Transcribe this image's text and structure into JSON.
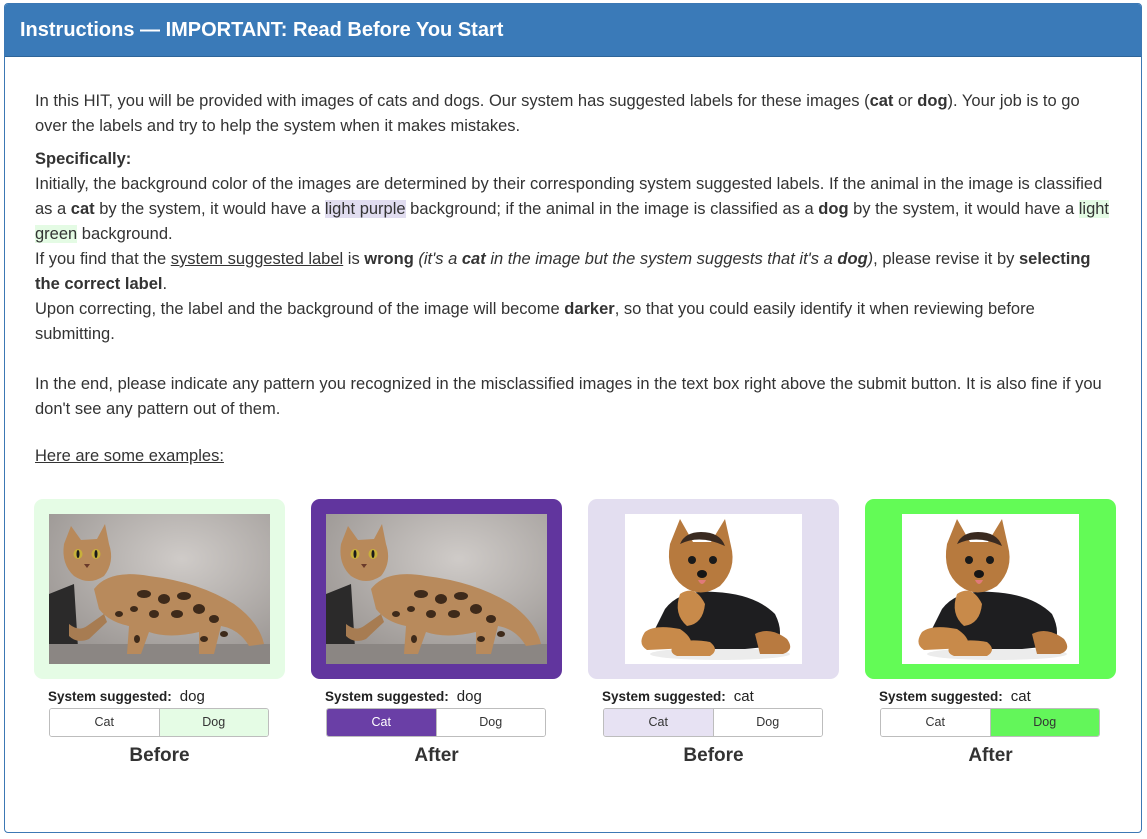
{
  "header": {
    "title": "Instructions — IMPORTANT: Read Before You Start"
  },
  "intro": {
    "t1": "In this HIT, you will be provided with images of cats and dogs. Our system has suggested labels for these images (",
    "cat": "cat",
    "or": " or ",
    "dog": "dog",
    "t2": "). Your job is to go over the labels and try to help the system when it makes mistakes."
  },
  "specifically": {
    "heading": "Specifically:",
    "s1": "Initially, the background color of the images are determined by their corresponding system suggested labels. If the animal in the image is classified as a ",
    "cat": "cat",
    "s2": " by the system, it would have a ",
    "light_purple": "light purple",
    "s3": " background; if the animal in the image is classified as a ",
    "dog": "dog",
    "s4": " by the system, it would have a ",
    "light_green": "light green",
    "s5": " background.",
    "s6": "If you find that the ",
    "system_suggested_label": "system suggested label",
    "s7": " is ",
    "wrong": "wrong",
    "s8": " (it's a ",
    "cat2": "cat",
    "s9": " in the image but the system suggests that it's a ",
    "dog2": "dog",
    "s10": ")",
    "s11": ", please revise it by ",
    "selecting": "selecting the correct label",
    "s12": ".",
    "s13": "Upon correcting, the label and the background of the image will become ",
    "darker": "darker",
    "s14": ", so that you could easily identify it when reviewing before submitting."
  },
  "pattern_text": "In the end, please indicate any pattern you recognized in the misclassified images in the text box right above the submit button. It is also fine if you don't see any pattern out of them.",
  "examples_title": "Here are some examples:",
  "examples": [
    {
      "animal": "cat",
      "bg_color": "#e5fce5",
      "system_label": "System suggested:",
      "suggested": "dog",
      "cat_btn": "Cat",
      "dog_btn": "Dog",
      "selected": "Dog",
      "selected_color": "#e5fce5",
      "selected_text_color": "#333333",
      "caption": "Before"
    },
    {
      "animal": "cat",
      "bg_color": "#61359e",
      "system_label": "System suggested:",
      "suggested": "dog",
      "cat_btn": "Cat",
      "dog_btn": "Dog",
      "selected": "Cat",
      "selected_color": "#6a3fa6",
      "selected_text_color": "#ffffff",
      "caption": "After"
    },
    {
      "animal": "dog",
      "bg_color": "#e3def0",
      "system_label": "System suggested:",
      "suggested": "cat",
      "cat_btn": "Cat",
      "dog_btn": "Dog",
      "selected": "Cat",
      "selected_color": "#e7e2f3",
      "selected_text_color": "#333333",
      "caption": "Before"
    },
    {
      "animal": "dog",
      "bg_color": "#63fb56",
      "system_label": "System suggested:",
      "suggested": "cat",
      "cat_btn": "Cat",
      "dog_btn": "Dog",
      "selected": "Dog",
      "selected_color": "#63f65a",
      "selected_text_color": "#333333",
      "caption": "After"
    }
  ]
}
